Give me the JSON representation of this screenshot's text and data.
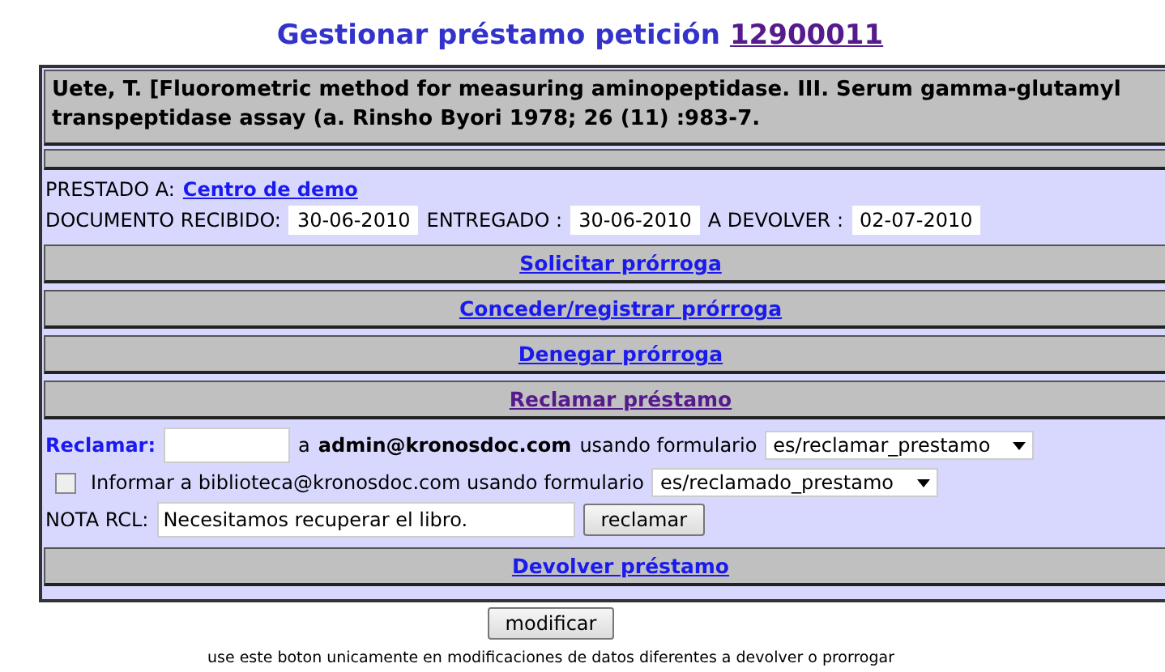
{
  "title": {
    "text": "Gestionar préstamo petición",
    "number": "12900011"
  },
  "citation": "Uete, T. [Fluorometric method for measuring aminopeptidase. III. Serum gamma-glutamyl transpeptidase assay (a. Rinsho Byori 1978; 26 (11) :983-7.",
  "loan": {
    "lent_to_label": "PRESTADO A:",
    "lent_to": "Centro de demo",
    "received_label": "DOCUMENTO RECIBIDO:",
    "received": "30-06-2010",
    "delivered_label": "ENTREGADO :",
    "delivered": "30-06-2010",
    "return_label": "A DEVOLVER :",
    "return": "02-07-2010"
  },
  "actions": [
    {
      "label": "Solicitar prórroga",
      "visited": false
    },
    {
      "label": "Conceder/registrar prórroga",
      "visited": false
    },
    {
      "label": "Denegar prórroga",
      "visited": false
    },
    {
      "label": "Reclamar préstamo",
      "visited": true
    }
  ],
  "claim": {
    "label": "Reclamar:",
    "to_prefix": "a",
    "email": "admin@kronosdoc.com",
    "using": "usando formulario",
    "form": "es/reclamar_prestamo",
    "inform_checked": false,
    "inform_text": "Informar a biblioteca@kronosdoc.com usando formulario",
    "inform_form": "es/reclamado_prestamo",
    "note_label": "NOTA RCL:",
    "note": "Necesitamos recuperar el libro.",
    "button": "reclamar"
  },
  "return_action": {
    "label": "Devolver préstamo",
    "visited": false
  },
  "modify_button": "modificar",
  "footnote": "use este boton unicamente en modificaciones de datos diferentes a devolver o prorrogar"
}
